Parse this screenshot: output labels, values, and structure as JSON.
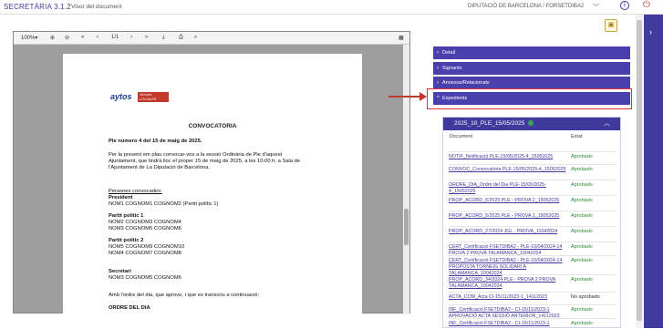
{
  "header": {
    "app_title": "SECRETÀRIA 3.1.2",
    "page_label": "Visor del document",
    "entity": "DIPUTACIÓ DE BARCELONA / FORSETDIBA2"
  },
  "viewer": {
    "zoom": "100%",
    "page_indicator": "1/1"
  },
  "document": {
    "logo_text": "aytos",
    "logo_badge": "Serveis LOCALES",
    "title": "CONVOCATORIA",
    "subtitle": "Ple número 4 del 15 de maig de 2025.",
    "paragraph_lines": [
      "Per la present em plau convocar-vos a la sessió Ordinària de Ple d'aquest",
      "Ajuntament, que tindrà lloc el proper 15 de maig de 2025, a les 10:00 h, a Sala de",
      "l'Ajuntament de La Diputació de Barcelona."
    ],
    "persons_heading": "Persones convocades:",
    "president_heading": "President",
    "president_line": "NOM1 COGNOM1 COGNOM2 (Partit polític 1)",
    "party1_heading": "Partit polític 1",
    "party1_lines": [
      "NOM2 COGNOM3 COGNOM4",
      "NOM3 COGNOM5 COGNOM6"
    ],
    "party2_heading": "Partit polític 2",
    "party2_lines": [
      "NOM5 COGNOM9 COGNOM10",
      "NOM4 COGNOM7 COGNOM8"
    ],
    "secretary_heading": "Secretari",
    "secretary_line": "NOM3 COGNOM5 COGNOM6",
    "order_intro": "Amb l'ordre del dia, que aprovo, i que es transcriu a continuació:",
    "order_heading": "ORDRE DEL DIA"
  },
  "accordions": {
    "detail": "Detall",
    "signatures": "Signants",
    "annexes": "Annexos/Relacionats",
    "expedients": "Expedients"
  },
  "expedient": {
    "title": "2025_10_PLE_15/05/2025",
    "col_document": "Document",
    "col_status": "Estat",
    "rows": [
      {
        "doc": "NOTIF_Notificació PLE-15/05/2025-4_15052025",
        "status": "Aprobado"
      },
      {
        "doc": "CONVOC_Convocatòria PLE-15/05/2025-4_15052025",
        "status": "Aprobado"
      },
      {
        "doc": "ORDRE_DIA_Ordre del Dia PLE-15/05/2025-4_15052025",
        "status": "Aprobado"
      },
      {
        "doc": "PROP_ACORD_6/2025 PLE - PROVA 2_15052025",
        "status": "Aprobado"
      },
      {
        "doc": "PROP_ACORD_5/2025 PLE - PROVA 1_15052025",
        "status": "Aprobado"
      },
      {
        "doc": "PROP_ACORD_27/2024 JGL - PROVA_11042024",
        "status": "Aprobado"
      },
      {
        "doc": "CERT_Certificació FSETDIBA2 - PLE-10/04/2024-14 PROVA 2 PROVA TALAMANCA_10042024",
        "status": "Aprobado"
      },
      {
        "doc": "CERT_Certificació FSETDIBA2 - PLE-10/04/2024-14 PROPOSTA TORNEIG SOLIDARI A TALAMANCA_10042024",
        "status": "Aprobado"
      },
      {
        "doc": "PROP_ACORD_34/2024 PLE - PROVA 2 PROVA TALAMANCA_10042024",
        "status": "Aprobado"
      },
      {
        "doc": "ACTA_COM_Acta CI-15/11/2023-1_14112023",
        "status": "No aprobado"
      },
      {
        "doc": "INF_Certificació FSETDIBA2 - CI-15/11/2023-1 APROVACIÓ ACTA SESSIÓ ANTERIOR_14112023",
        "status": "Aprobado"
      },
      {
        "doc": "INF_Certificació FSETDIBA2 - CI-15/11/2023-1",
        "status": "Aprobado"
      }
    ]
  },
  "colors": {
    "brand": "#3f3a9c",
    "accordion": "#4b3fae",
    "approved": "#2e8b3a",
    "highlight": "#d33333"
  }
}
